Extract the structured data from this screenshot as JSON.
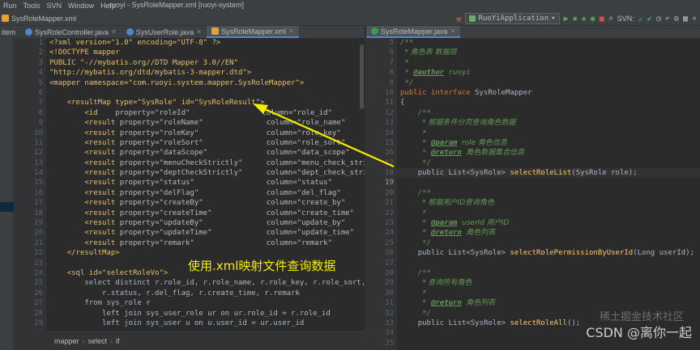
{
  "menu": {
    "items": [
      "Run",
      "Tools",
      "SVN",
      "Window",
      "Help"
    ],
    "window_title": "ruoyi - SysRoleMapper.xml [ruoyi-system]"
  },
  "navbar": {
    "breadcrumb_item": "SysRoleMapper.xml",
    "side_label": "item",
    "run_config": "RuoYiApplication",
    "svn_label": "SVN:"
  },
  "tabs_left": [
    {
      "label": "SysRoleController.java",
      "color": "#4a86c8"
    },
    {
      "label": "SysUserRole.java",
      "color": "#4a86c8"
    },
    {
      "label": "SysRoleMapper.xml",
      "color": "#e3a23b"
    }
  ],
  "tabs_right": [
    {
      "label": "SysRoleMapper.java",
      "color": "#3e9a5a"
    }
  ],
  "left_gutter": {
    "line_numbers": [
      "1",
      "2",
      "3",
      "4",
      "5",
      "6",
      "7",
      "8",
      "9",
      "10",
      "11",
      "12",
      "13",
      "14",
      "15",
      "16",
      "17",
      "18",
      "19",
      "20",
      "21",
      "22",
      "23",
      "24",
      "25",
      "26",
      "27",
      "28",
      "29"
    ]
  },
  "right_gutter": {
    "line_numbers": [
      "5",
      "6",
      "7",
      "8",
      "9",
      "10",
      "11",
      "12",
      "13",
      "14",
      "15",
      "16",
      "17",
      "18",
      "19",
      "20",
      "21",
      "22",
      "23",
      "24",
      "25",
      "26",
      "27",
      "28",
      "29",
      "30",
      "31",
      "32",
      "33",
      "34",
      "35"
    ],
    "current": "19"
  },
  "xml_code": {
    "decl": "<?xml version=\"1.0\" encoding=\"UTF-8\" ?>",
    "doctype": "<!DOCTYPE mapper",
    "public_id": "PUBLIC \"-//mybatis.org//DTD Mapper 3.0//EN\"",
    "dtd_url": "\"http://mybatis.org/dtd/mybatis-3-mapper.dtd\">",
    "mapper_open": "<mapper namespace=\"com.ruoyi.system.mapper.SysRoleMapper\">",
    "resultmap_open": "<resultMap type=\"SysRole\" id=\"SysRoleResult\">",
    "fields": [
      {
        "tag": "<id",
        "property": "property=\"roleId\"",
        "column": "column=\"role_id\""
      },
      {
        "tag": "<result",
        "property": "property=\"roleName\"",
        "column": "column=\"role_name\""
      },
      {
        "tag": "<result",
        "property": "property=\"roleKey\"",
        "column": "column=\"role_key\""
      },
      {
        "tag": "<result",
        "property": "property=\"roleSort\"",
        "column": "column=\"role_sort\""
      },
      {
        "tag": "<result",
        "property": "property=\"dataScope\"",
        "column": "column=\"data_scope\""
      },
      {
        "tag": "<result",
        "property": "property=\"menuCheckStrictly\"",
        "column": "column=\"menu_check_strictly\""
      },
      {
        "tag": "<result",
        "property": "property=\"deptCheckStrictly\"",
        "column": "column=\"dept_check_strictly\""
      },
      {
        "tag": "<result",
        "property": "property=\"status\"",
        "column": "column=\"status\""
      },
      {
        "tag": "<result",
        "property": "property=\"delFlag\"",
        "column": "column=\"del_flag\""
      },
      {
        "tag": "<result",
        "property": "property=\"createBy\"",
        "column": "column=\"create_by\""
      },
      {
        "tag": "<result",
        "property": "property=\"createTime\"",
        "column": "column=\"create_time\""
      },
      {
        "tag": "<result",
        "property": "property=\"updateBy\"",
        "column": "column=\"update_by\""
      },
      {
        "tag": "<result",
        "property": "property=\"updateTime\"",
        "column": "column=\"update_time\""
      },
      {
        "tag": "<result",
        "property": "property=\"remark\"",
        "column": "column=\"remark\""
      }
    ],
    "field_close": "/>",
    "resultmap_close": "</resultMap>",
    "sql_open": "<sql id=\"selectRoleVo\">",
    "sql_1": "select distinct r.role_id, r.role_name, r.role_key, r.role_sort, r.data_sc",
    "sql_2": "r.status, r.del_flag, r.create_time, r.remark",
    "sql_3": "from sys_role r",
    "sql_4": "left join sys_user_role ur on ur.role_id = r.role_id",
    "sql_5": "left join sys_user u on u.user_id = ur.user_id"
  },
  "java_code": {
    "l1": "/**",
    "l2": "* 角色表 数据层",
    "l3": "*",
    "l4_tag": "@author",
    "l4_val": "ruoyi",
    "l5": "*/",
    "l6_kw": "public interface",
    "l6_name": "SysRoleMapper",
    "l7": "{",
    "l8": "/**",
    "l9": "* 根据条件分页查询角色数据",
    "l10": "*",
    "l11_tag": "@param",
    "l11_val": "role 角色信息",
    "l12_tag": "@return",
    "l12_val": "角色数据集合信息",
    "l13": "*/",
    "l14_sig": "public List<SysRole> ",
    "l14_fn": "selectRoleList",
    "l14_args": "(SysRole role);",
    "l15": "",
    "l16": "/**",
    "l17": "* 根据用户ID查询角色",
    "l18": "*",
    "l19_tag": "@param",
    "l19_val": "userId 用户ID",
    "l20_tag": "@return",
    "l20_val": "角色列表",
    "l21": "*/",
    "l22_sig": "public List<SysRole> ",
    "l22_fn": "selectRolePermissionByUserId",
    "l22_args": "(Long userId);",
    "l23": "",
    "l24": "/**",
    "l25": "* 查询所有角色",
    "l26": "*",
    "l27_tag": "@return",
    "l27_val": "角色列表",
    "l28": "*/",
    "l29_sig": "public List<SysRole> ",
    "l29_fn": "selectRoleAll",
    "l29_args": "();"
  },
  "breadcrumb_bottom": [
    "mapper",
    "select",
    "if"
  ],
  "annotation_text": "使用.xml映射文件查询数据",
  "watermark": "CSDN @离你一起",
  "watermark2": "稀土掘金技术社区",
  "colors": {
    "annotation": "#f5ec00",
    "arrow": "#f5ec00",
    "accent": "#4a88c7"
  }
}
